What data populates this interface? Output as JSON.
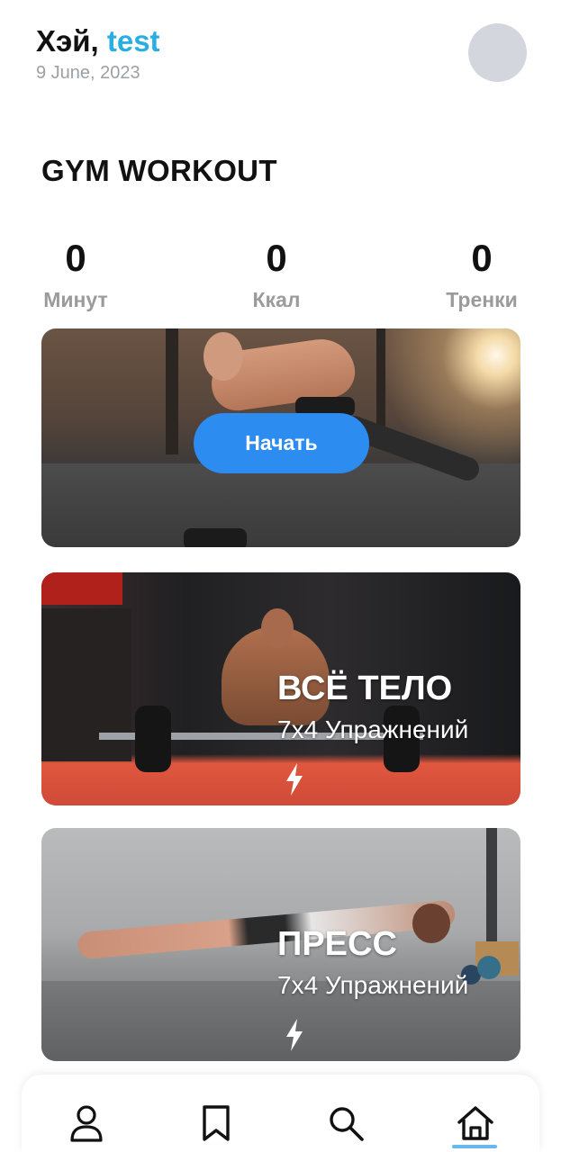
{
  "header": {
    "greeting_prefix": "Хэй, ",
    "username": "test",
    "date": "9 June, 2023"
  },
  "section": {
    "title": "GYM WORKOUT"
  },
  "stats": [
    {
      "value": "0",
      "label": "Минут"
    },
    {
      "value": "0",
      "label": "Ккал"
    },
    {
      "value": "0",
      "label": "Тренки"
    }
  ],
  "hero": {
    "start_label": "Начать"
  },
  "workouts": [
    {
      "title": "ВСЁ ТЕЛО",
      "subtitle": "7x4 Упражнений",
      "icon": "lightning-bolt-icon"
    },
    {
      "title": "ПРЕСС",
      "subtitle": "7x4 Упражнений",
      "icon": "lightning-bolt-icon"
    }
  ],
  "nav": {
    "items": [
      {
        "icon": "person-icon",
        "active": false
      },
      {
        "icon": "bookmark-icon",
        "active": false
      },
      {
        "icon": "search-icon",
        "active": false
      },
      {
        "icon": "home-icon",
        "active": true
      }
    ]
  },
  "colors": {
    "accent": "#29aee3",
    "button": "#2d8cf0",
    "nav_indicator": "#66b8ee",
    "muted_text": "#9b9b9b",
    "avatar_bg": "#d3d6dc"
  }
}
